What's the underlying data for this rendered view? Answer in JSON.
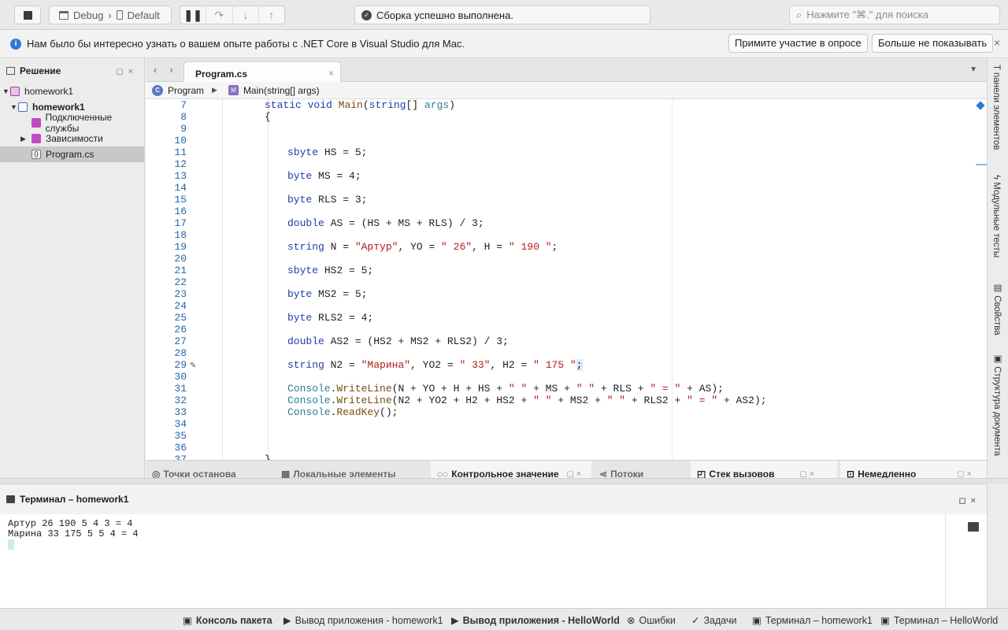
{
  "toolbar": {
    "config": "Debug",
    "device": "Default",
    "status": "Сборка успешно выполнена.",
    "search_placeholder": "Нажмите \"⌘.\" для поиска"
  },
  "infobar": {
    "text": "Нам было бы интересно узнать о вашем опыте работы с .NET Core в Visual Studio для Mac.",
    "survey_button": "Примите участие в опросе",
    "dontshow_button": "Больше не показывать"
  },
  "solution": {
    "title": "Решение",
    "items": [
      {
        "label": "homework1"
      },
      {
        "label": "homework1"
      },
      {
        "label": "Подключенные службы"
      },
      {
        "label": "Зависимости"
      },
      {
        "label": "Program.cs"
      }
    ]
  },
  "editor": {
    "tab": "Program.cs",
    "crumb_class": "Program",
    "crumb_method": "Main(string[] args)",
    "line_numbers": [
      "7",
      "8",
      "9",
      "10",
      "11",
      "12",
      "13",
      "14",
      "15",
      "16",
      "17",
      "18",
      "19",
      "20",
      "21",
      "22",
      "23",
      "24",
      "25",
      "26",
      "27",
      "28",
      "29",
      "30",
      "31",
      "32",
      "33",
      "34",
      "35",
      "36",
      "37"
    ]
  },
  "bottom_tabs": {
    "breakpoints": "Точки останова",
    "locals": "Локальные элементы",
    "watch": "Контрольное значение",
    "threads": "Потоки",
    "callstack": "Стек вызовов",
    "immediate": "Немедленно"
  },
  "terminal": {
    "title": "Терминал – homework1",
    "line1": "Артур 26 190 5 4 3 = 4",
    "line2": "Марина 33 175 5 5 4 = 4"
  },
  "statusbar": {
    "package_console": "Консоль пакета",
    "app_output_hw1": "Вывод приложения - homework1",
    "app_output_hello": "Вывод приложения - HelloWorld",
    "errors": "Ошибки",
    "tasks": "Задачи",
    "terminal_hw1": "Терминал – homework1",
    "terminal_hello": "Терминал – HelloWorld"
  },
  "right_rail": {
    "toolbox": "панели элементов",
    "unit_tests": "Модульные тесты",
    "properties": "Свойства",
    "doc_outline": "Структура документа"
  }
}
